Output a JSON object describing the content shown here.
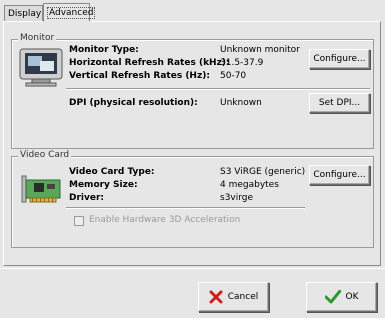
{
  "tabs": [
    {
      "label": "Display"
    },
    {
      "label": "Advanced",
      "active": true
    }
  ],
  "monitor": {
    "section_title": "Monitor",
    "type_label": "Monitor Type:",
    "type_value": "Unknown monitor",
    "hrate_label": "Horizontal Refresh Rates (kHz):",
    "hrate_value": "31.5-37.9",
    "vrate_label": "Vertical Refresh Rates (Hz):",
    "vrate_value": "50-70",
    "configure_label": "Configure...",
    "dpi_label": "DPI (physical resolution):",
    "dpi_value": "Unknown",
    "setdpi_label": "Set DPI..."
  },
  "video": {
    "section_title": "Video Card",
    "type_label": "Video Card Type:",
    "type_value": "S3 ViRGE (generic)",
    "memory_label": "Memory Size:",
    "memory_value": "4 megabytes",
    "driver_label": "Driver:",
    "driver_value": "s3virge",
    "configure_label": "Configure...",
    "accel_label": "Enable Hardware 3D Acceleration",
    "accel_checked": false,
    "accel_enabled": false
  },
  "actions": {
    "cancel_label": "Cancel",
    "ok_label": "OK"
  },
  "colors": {
    "cancel_icon": "#cc2020",
    "ok_icon": "#2e9a2e"
  }
}
